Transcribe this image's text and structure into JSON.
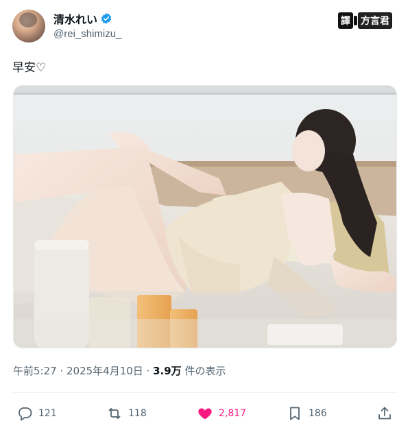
{
  "user": {
    "display_name": "清水れい",
    "handle": "@rei_shimizu_",
    "verified": true
  },
  "watermark": {
    "part1": "譯",
    "part2": "方言君"
  },
  "tweet": {
    "text": "早安♡",
    "photo": "photo of a woman in a cream lace camisole reclining on a couch, pale window light, candles in foreground"
  },
  "meta": {
    "timestamp": "午前5:27 · 2025年4月10日 · ",
    "views_count": "3.9万",
    "views_label": " 件の表示"
  },
  "actions": {
    "replies": "121",
    "reposts": "118",
    "likes": "2,817",
    "bookmarks": "186"
  },
  "colors": {
    "like": "#f91880",
    "verified": "#1d9bf0",
    "muted_text": "#536471"
  }
}
